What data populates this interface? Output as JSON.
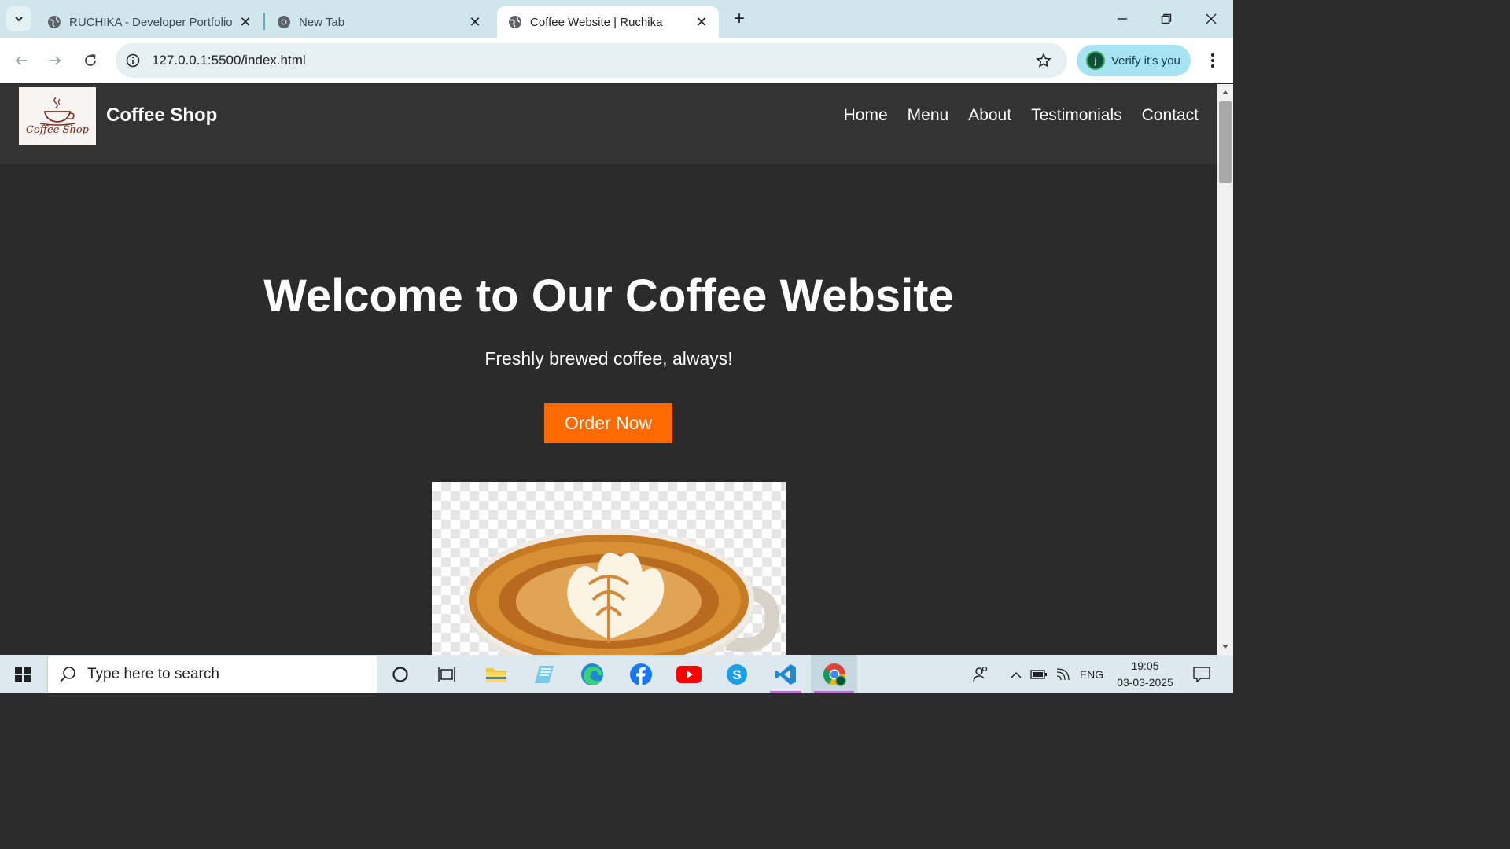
{
  "browser": {
    "tabs": [
      {
        "title": "RUCHIKA - Developer Portfolio",
        "active": false
      },
      {
        "title": "New Tab",
        "active": false
      },
      {
        "title": "Coffee Website | Ruchika",
        "active": true
      }
    ],
    "url": "127.0.0.1:5500/index.html",
    "profile_chip_label": "Verify it's you",
    "profile_initial": "j"
  },
  "site": {
    "logo_text": "Coffee Shop",
    "brand": "Coffee Shop",
    "nav": [
      "Home",
      "Menu",
      "About",
      "Testimonials",
      "Contact"
    ],
    "hero": {
      "title": "Welcome to Our Coffee Website",
      "subtitle": "Freshly brewed coffee, always!",
      "cta": "Order Now"
    },
    "colors": {
      "accent": "#ff6a00",
      "header_bg": "#333333",
      "page_bg": "#2b2b2b"
    }
  },
  "taskbar": {
    "search_placeholder": "Type here to search",
    "language": "ENG",
    "time": "19:05",
    "date": "03-03-2025",
    "apps": [
      "task-view",
      "file-explorer",
      "notepad",
      "edge",
      "facebook",
      "youtube",
      "skype",
      "vscode",
      "chrome"
    ]
  }
}
